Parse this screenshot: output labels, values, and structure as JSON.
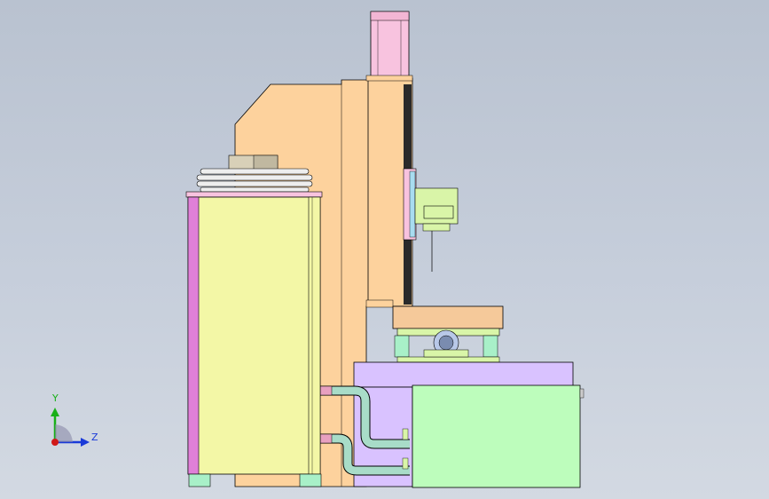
{
  "viewport": {
    "background_top": "#b9c2d0",
    "background_bottom": "#d3d9e2"
  },
  "model": {
    "colors": {
      "frame": "#fdd29d",
      "tank_body": "#f3f7a6",
      "tank_edge": "#e080d8",
      "pump_box": "#d9c2ff",
      "reservoir": "#bdfdbc",
      "motor": "#f8c3df",
      "pipe": "#a8dcc8",
      "pipe_red": "#e8a0c0",
      "base_blocks": "#a8f0c8",
      "table": "#f5c99a",
      "fixture": "#d9f5a8",
      "bearing": "#b8c8e8",
      "outline": "#000000"
    }
  },
  "triad": {
    "y_label": "Y",
    "z_label": "Z",
    "y_color": "#18b018",
    "z_color": "#1a3ad8",
    "x_color": "#d01818"
  }
}
